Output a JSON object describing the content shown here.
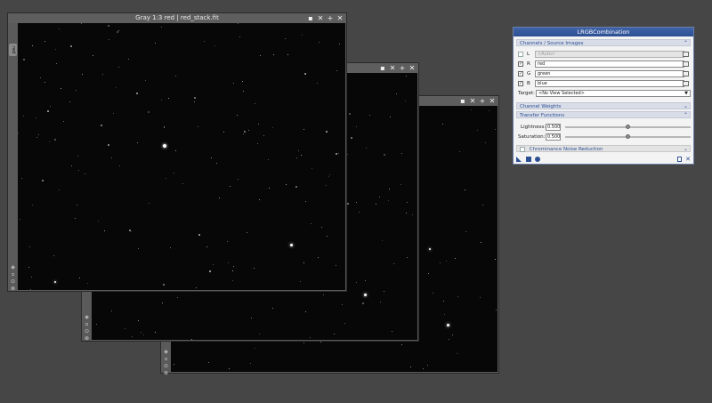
{
  "windows": {
    "w1": {
      "title": "Gray 1:3 red | red_stack.fit",
      "tab": "red",
      "controls": [
        "▪",
        "✕",
        "+",
        "✕"
      ]
    },
    "w2": {
      "title": "",
      "controls": [
        "▪",
        "✕",
        "+",
        "✕"
      ]
    },
    "w3": {
      "title": "",
      "controls": [
        "▪",
        "✕",
        "+",
        "✕"
      ]
    }
  },
  "panel": {
    "title": "LRGBCombination",
    "channels": {
      "header": "Channels / Source Images",
      "rows": [
        {
          "label": "L",
          "value": "<Auto>",
          "checked": false
        },
        {
          "label": "R",
          "value": "red",
          "checked": true
        },
        {
          "label": "G",
          "value": "green",
          "checked": true
        },
        {
          "label": "B",
          "value": "blue",
          "checked": true
        }
      ],
      "target_label": "Target:",
      "target_value": "<No View Selected>"
    },
    "weights_header": "Channel Weights",
    "transfer_header": "Transfer Functions",
    "lightness": {
      "label": "Lightness:",
      "value": "0.500",
      "fraction": 0.5
    },
    "saturation": {
      "label": "Saturation:",
      "value": "0.500",
      "fraction": 0.5
    },
    "cnr_header": "Chrominance Noise Reduction",
    "accent": "#2d4f93"
  }
}
